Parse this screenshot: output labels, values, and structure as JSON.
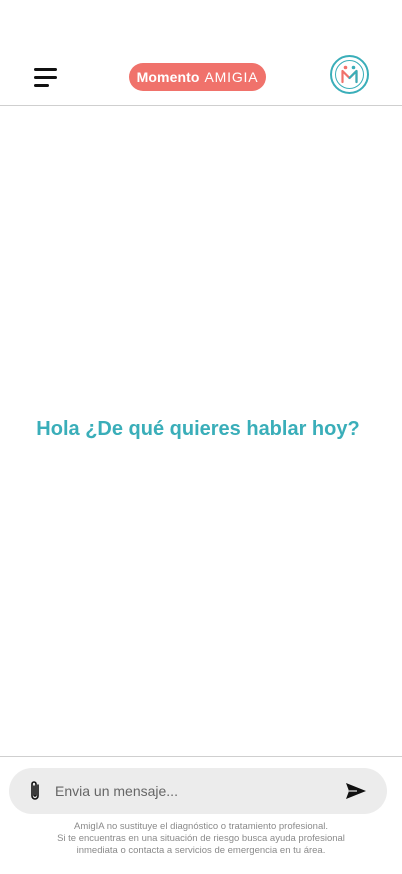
{
  "header": {
    "brand": {
      "word": "Momento",
      "amigia": "AMIGIA"
    },
    "menu_icon": "hamburger-menu-icon",
    "avatar_icon": "momento-amigia-logo-icon"
  },
  "main": {
    "greeting": "Hola ¿De qué quieres hablar hoy?"
  },
  "composer": {
    "placeholder": "Envia un mensaje...",
    "attach_icon": "paperclip-icon",
    "send_icon": "send-icon"
  },
  "disclaimer": {
    "line1": "AmigIA no sustituye el diagnóstico o tratamiento profesional.",
    "line2": "Si te encuentras en una situación de riesgo busca ayuda profesional",
    "line3": "inmediata o contacta a servicios de emergencia en tu área."
  },
  "colors": {
    "accent_teal": "#3aaeb9",
    "brand_coral": "#f0726b",
    "composer_bg": "#ececec"
  }
}
